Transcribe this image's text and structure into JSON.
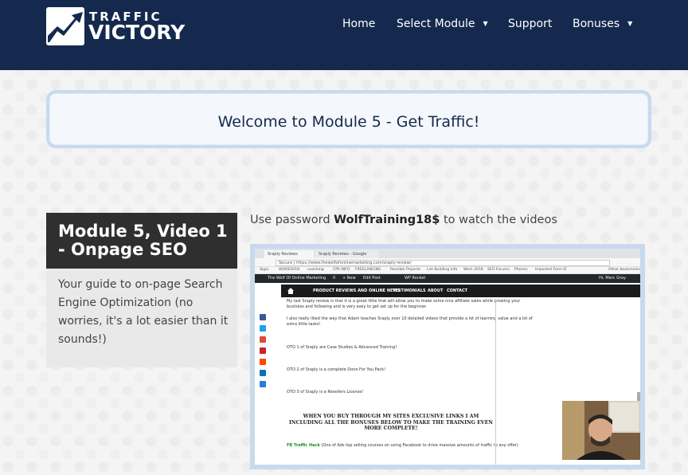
{
  "header": {
    "logo_line1": "TRAFFIC",
    "logo_line2": "VICTORY",
    "nav": [
      {
        "label": "Home",
        "has_caret": false
      },
      {
        "label": "Select Module",
        "has_caret": true
      },
      {
        "label": "Support",
        "has_caret": false
      },
      {
        "label": "Bonuses",
        "has_caret": true
      }
    ],
    "caret_icon": "▼"
  },
  "welcome": {
    "title": "Welcome to Module 5 - Get Traffic!"
  },
  "module_card": {
    "title": "Module 5, Video 1 - Onpage SEO",
    "description": "Your guide to on-page Search Engine Optimization (no worries, it's a lot easier than it sounds!)"
  },
  "password_line": {
    "prefix": "Use password ",
    "password": "WolfTraining18$",
    "suffix": " to watch the videos"
  },
  "video": {
    "tabs": [
      "Sraply Reviews",
      "Sraply Reviews - Google"
    ],
    "url": "Secure | https://www.thewolfofonlinemarketing.com/sraply-review/",
    "bookmarks": [
      "Apps",
      "WORK2018",
      "coaching",
      "CPA INFO",
      "FREELANCING",
      "Possible Projects",
      "List Building Info",
      "Work 2018",
      "SEO Forums",
      "Phones",
      "Imported From IE",
      "Other bookmarks"
    ],
    "wp_bar": [
      "The Wolf Of Online Marketing",
      "0",
      "+ New",
      "Edit Post",
      "WP Rocket",
      "Hi, Marc Gray"
    ],
    "site_nav": [
      "PRODUCT REVIEWS AND ONLINE NEWS",
      "TESTIMONIALS",
      "ABOUT",
      "CONTACT"
    ],
    "lines": [
      "My last Sraply review is that it is a great little that will allow you to make some nice affiliate sales while growing your",
      "business and following and is very easy to get set up for the beginner.",
      "I also really liked the way that Adam teaches Sraply over 10 detailed videos that provide a lot of learning value and a lot of",
      "extra little tasks!",
      "OTO 1 of Sraply are Case Studies & Advanced Training!",
      "OTO 2 of Sraply is a complete Done For You Pack!",
      "OTO 3 of Sraply is a Resellers License!"
    ],
    "bonus_heading": "WHEN YOU BUY THROUGH MY SITES EXCLUSIVE LINKS I AM INCLUDING ALL THE BONUSES BELOW TO MAKE THE TRAINING EVEN MORE COMPLETE!",
    "fb_label": "FB Traffic Hack",
    "fb_text": " (One of Ads top selling courses on using Facebook to drive massive amounts of traffic to any offer)",
    "share_colors": [
      "#3b5998",
      "#1da1f2",
      "#dd4b39",
      "#cb2027",
      "#ff4500",
      "#0077b5",
      "#2a7ae2"
    ]
  },
  "colors": {
    "header_bg": "#14294d",
    "accent_border": "#c9d9ee",
    "card_dark": "#2f2f2f",
    "card_light": "#e9e9e9"
  }
}
